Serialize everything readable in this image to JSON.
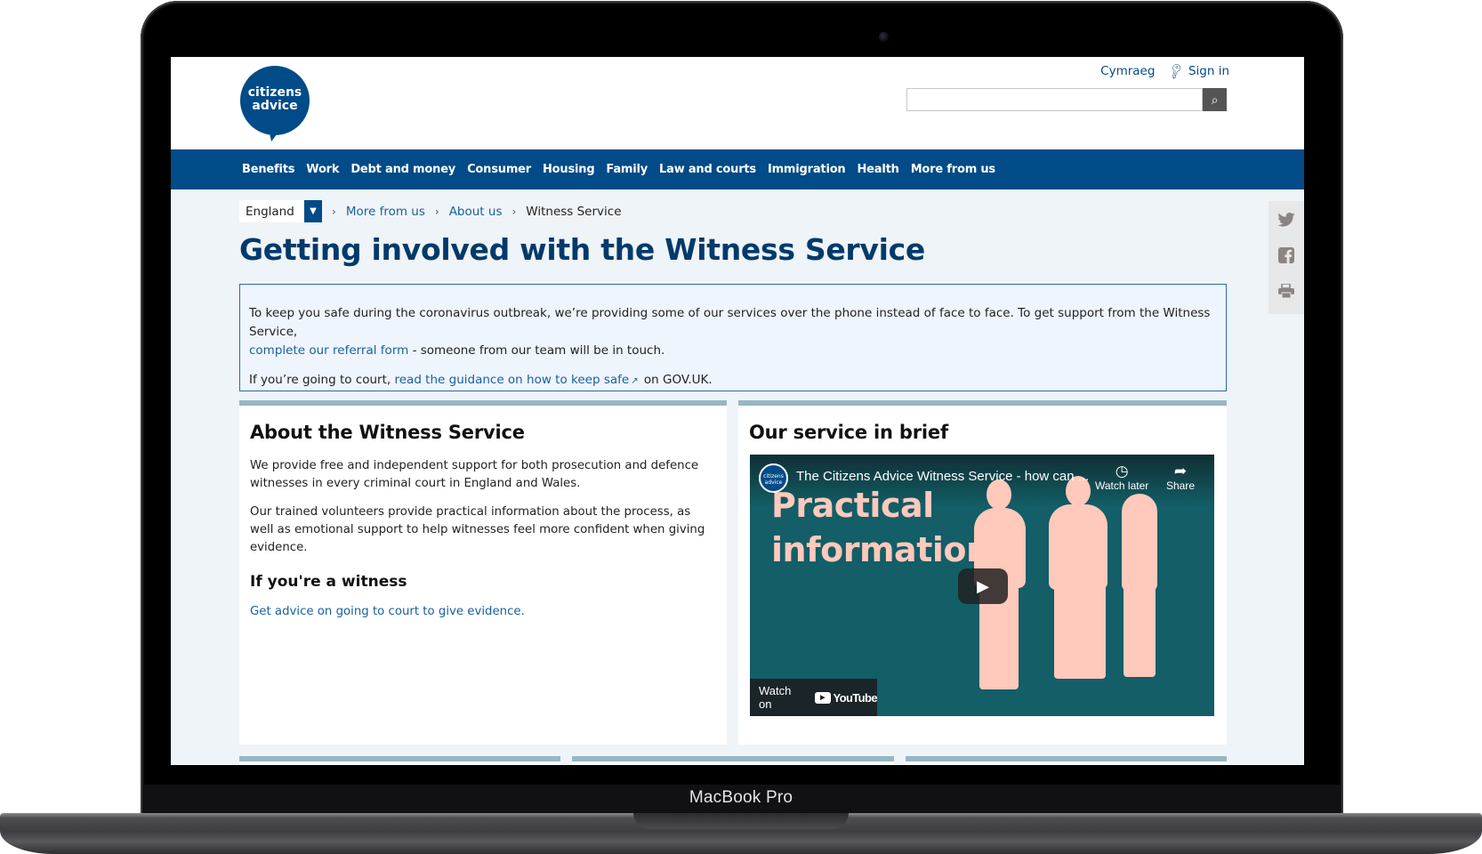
{
  "device": {
    "label": "MacBook Pro"
  },
  "header": {
    "logo_line1": "citizens",
    "logo_line2": "advice",
    "language_link": "Cymraeg",
    "sign_in": "Sign in",
    "search": {
      "value": "",
      "placeholder": ""
    }
  },
  "nav": {
    "items": [
      "Benefits",
      "Work",
      "Debt and money",
      "Consumer",
      "Housing",
      "Family",
      "Law and courts",
      "Immigration",
      "Health",
      "More from us"
    ]
  },
  "breadcrumb": {
    "region": "England",
    "items": [
      "More from us",
      "About us"
    ],
    "current": "Witness Service"
  },
  "page": {
    "title": "Getting involved with the Witness Service"
  },
  "notice": {
    "line1": "To keep you safe during the coronavirus outbreak, we’re providing some of our services over the phone instead of face to face. To get support from the Witness Service,",
    "referral_link": "complete our referral form",
    "line1_tail": " - someone from our team will be in touch.",
    "line2_prefix": "If you’re going to court, ",
    "guidance_link": "read the guidance on how to keep safe",
    "line2_suffix": " on GOV.UK."
  },
  "about_card": {
    "heading": "About the Witness Service",
    "para1": "We provide free and independent support for both prosecution and defence witnesses in every criminal court in England and Wales.",
    "para2": "Our trained volunteers provide practical information about the process, as well as emotional support to help witnesses feel more confident when giving evidence.",
    "subheading": "If you're a witness",
    "link": "Get advice on going to court to give evidence."
  },
  "video_card": {
    "heading": "Our service in brief",
    "video": {
      "channel_avatar": "citizens advice",
      "title": "The Citizens Advice Witness Service - how can ...",
      "watch_later": "Watch later",
      "share": "Share",
      "thumbnail_line1": "Practical",
      "thumbnail_line2": "information",
      "watch_on": "Watch on",
      "youtube": "YouTube"
    }
  },
  "share_panel": {
    "icons": [
      "twitter-icon",
      "facebook-icon",
      "print-icon"
    ]
  },
  "colors": {
    "brand_blue": "#004b88",
    "link_blue": "#1a5f9e",
    "title_blue": "#003a6b",
    "card_bar": "#97b6c6",
    "video_teal": "#135e67",
    "thumbnail_pink": "#ffc9bc"
  }
}
